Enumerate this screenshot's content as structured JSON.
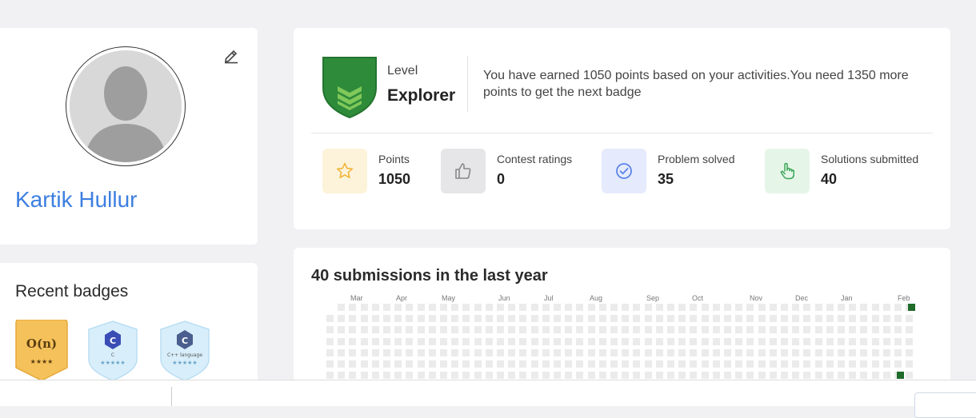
{
  "profile": {
    "name": "Kartik Hullur"
  },
  "recent_badges": {
    "title": "Recent badges",
    "items": [
      {
        "symbol": "O(n)",
        "caption": "",
        "stars": "★★★★",
        "color": "#f5c15b",
        "icon": "big-o-badge-icon"
      },
      {
        "symbol": "C",
        "caption": "C",
        "stars": "★★★★★",
        "color": "#cfe9f7",
        "icon": "c-language-badge-icon"
      },
      {
        "symbol": "C",
        "caption": "C++ language",
        "stars": "★★★★★",
        "color": "#cfe9f7",
        "icon": "cpp-language-badge-icon"
      }
    ]
  },
  "level": {
    "label": "Level",
    "name": "Explorer",
    "message": "You have earned 1050 points based on your activities.You need 1350 more points to get the next badge",
    "shield_color": "#2e8b3a"
  },
  "stats": [
    {
      "label": "Points",
      "value": "1050",
      "icon": "star-icon",
      "bg": "#fdf3da",
      "color": "#f0b53a"
    },
    {
      "label": "Contest ratings",
      "value": "0",
      "icon": "thumbs-up-icon",
      "bg": "#e6e6e8",
      "color": "#888"
    },
    {
      "label": "Problem solved",
      "value": "35",
      "icon": "check-circle-icon",
      "bg": "#e5ebfc",
      "color": "#5b84e8"
    },
    {
      "label": "Solutions submitted",
      "value": "40",
      "icon": "pointer-hand-icon",
      "bg": "#e5f6e8",
      "color": "#3aa558"
    }
  ],
  "submissions": {
    "title": "40 submissions in the last year",
    "months": [
      "Mar",
      "Apr",
      "May",
      "Jun",
      "Jul",
      "Aug",
      "Sep",
      "Oct",
      "Nov",
      "Dec",
      "Jan",
      "Feb"
    ],
    "active_color": "#1e6b2a",
    "empty_color": "#ebebeb"
  },
  "bottom_bar": {
    "left_text": "",
    "button_label": ""
  }
}
